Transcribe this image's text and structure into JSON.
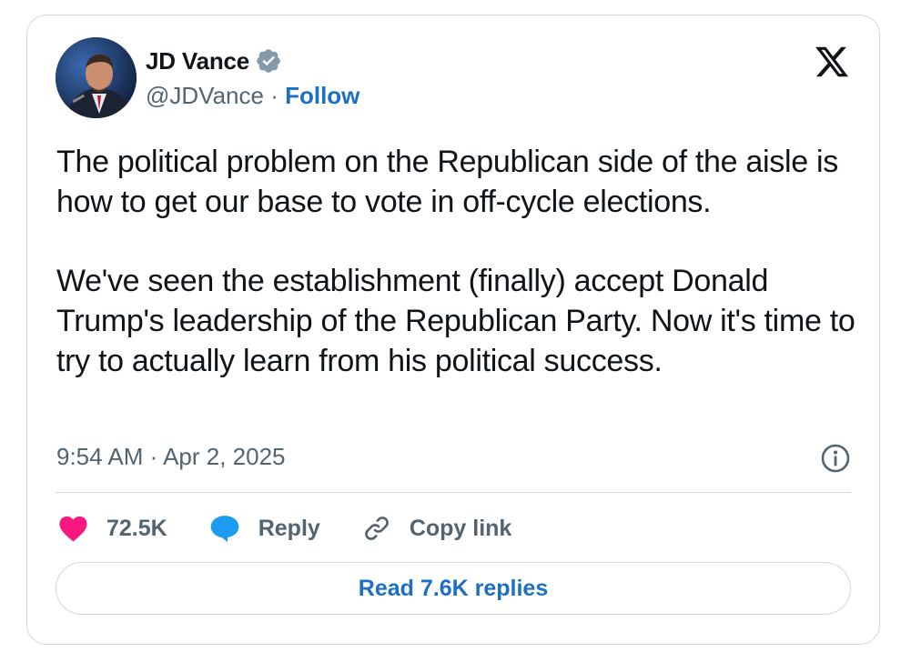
{
  "author": {
    "name": "JD Vance",
    "handle": "@JDVance",
    "separator": " · ",
    "follow_label": "Follow",
    "verified_icon": "verified-badge-icon"
  },
  "tweet": {
    "paragraphs": [
      "The political problem on the Republican side of the aisle is how to get our base to vote in off-cycle elections.",
      "We've seen the establishment (finally) accept Donald Trump's leadership of the Republican Party. Now it's time to try to actually learn from his political success."
    ],
    "timestamp": "9:54 AM · Apr 2, 2025"
  },
  "actions": {
    "like_count": "72.5K",
    "reply_label": "Reply",
    "copy_link_label": "Copy link",
    "read_replies_label": "Read 7.6K replies"
  },
  "colors": {
    "like": "#f91880",
    "reply": "#1d9bf0",
    "link": "#1d6fc2",
    "muted": "#536471",
    "border": "#cfd9de"
  },
  "icons": [
    "x-logo-icon",
    "info-icon",
    "heart-icon",
    "reply-bubble-icon",
    "link-icon"
  ]
}
